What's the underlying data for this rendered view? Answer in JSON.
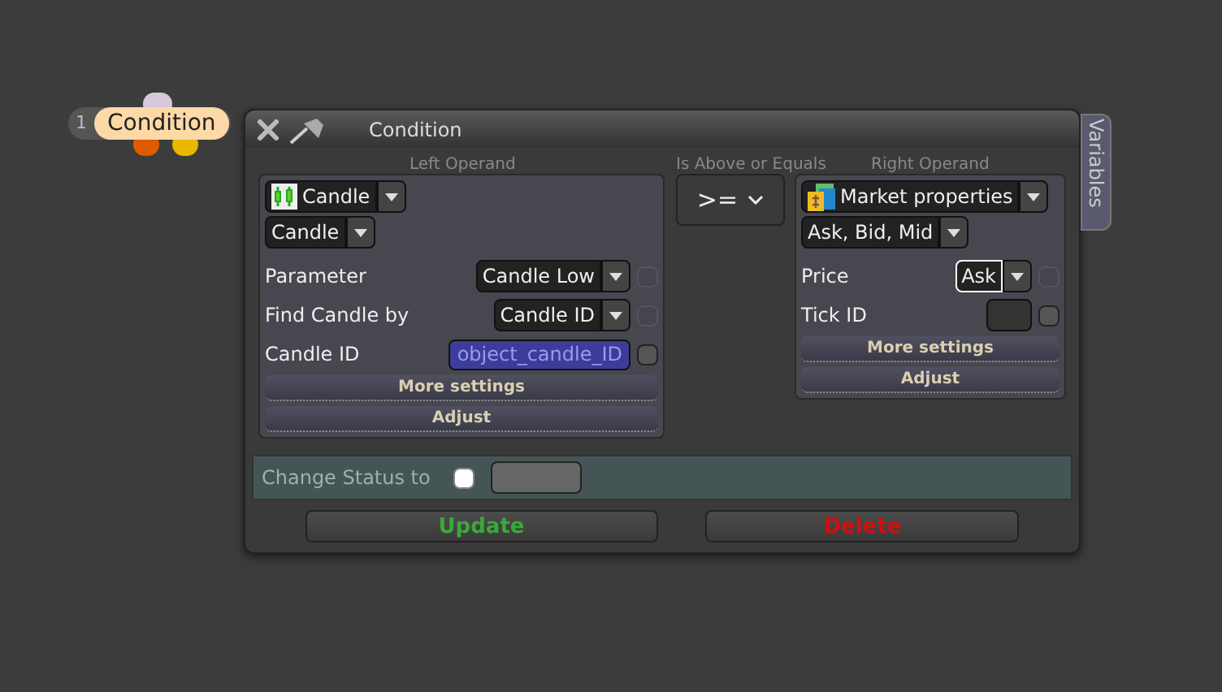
{
  "node": {
    "index": "1",
    "label": "Condition"
  },
  "dialog": {
    "title": "Condition",
    "side_tab": "Variables",
    "left": {
      "heading": "Left Operand",
      "source": "Candle",
      "type": "Candle",
      "params": [
        {
          "kind": "select",
          "label": "Parameter",
          "value": "Candle Low",
          "checked": false,
          "focused": false
        },
        {
          "kind": "select",
          "label": "Find Candle by",
          "value": "Candle ID",
          "checked": false,
          "focused": false
        },
        {
          "kind": "variable",
          "label": "Candle ID",
          "value": "object_candle_ID",
          "checked": false,
          "focused": false
        }
      ],
      "buttons": [
        "More settings",
        "Adjust"
      ]
    },
    "operator": {
      "heading": "Is Above or Equals",
      "value": ">="
    },
    "right": {
      "heading": "Right Operand",
      "source": "Market properties",
      "type": "Ask, Bid, Mid",
      "params": [
        {
          "kind": "select",
          "label": "Price",
          "value": "Ask",
          "checked": false,
          "focused": true
        },
        {
          "kind": "input",
          "label": "Tick ID",
          "checked": false,
          "focused": false
        }
      ],
      "buttons": [
        "More settings",
        "Adjust"
      ]
    },
    "status": {
      "label": "Change Status to",
      "checked": false
    },
    "actions": [
      {
        "kind": "confirm",
        "label": "Update"
      },
      {
        "kind": "danger",
        "label": "Delete"
      }
    ]
  }
}
